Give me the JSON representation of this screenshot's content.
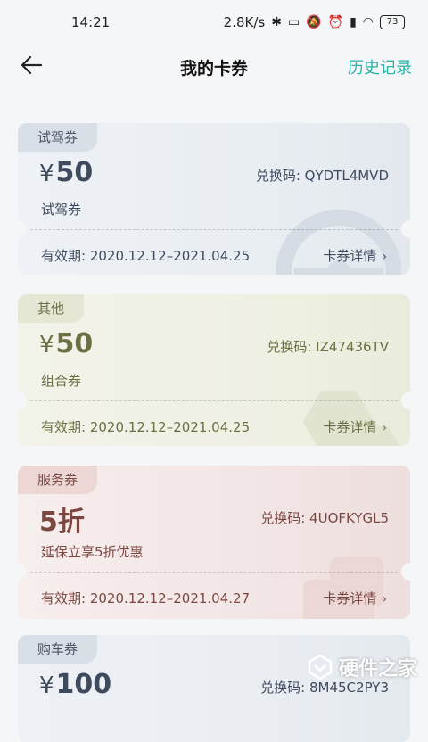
{
  "status_bar": {
    "time": "14:21",
    "speed": "2.8K/s",
    "battery": "73"
  },
  "header": {
    "title": "我的卡券",
    "history": "历史记录"
  },
  "coupons": [
    {
      "tag": "试驾券",
      "currency": "¥",
      "amount": "50",
      "name": "试驾券",
      "code_label": "兑换码:",
      "code": "QYDTL4MVD",
      "validity_label": "有效期:",
      "validity": "2020.12.12–2021.04.25",
      "detail": "卡券详情"
    },
    {
      "tag": "其他",
      "currency": "¥",
      "amount": "50",
      "name": "组合券",
      "code_label": "兑换码:",
      "code": "IZ47436TV",
      "validity_label": "有效期:",
      "validity": "2020.12.12–2021.04.25",
      "detail": "卡券详情"
    },
    {
      "tag": "服务券",
      "amount": "5折",
      "name": "延保立享5折优惠",
      "code_label": "兑换码:",
      "code": "4UOFKYGL5",
      "validity_label": "有效期:",
      "validity": "2020.12.12–2021.04.27",
      "detail": "卡券详情"
    },
    {
      "tag": "购车券",
      "currency": "¥",
      "amount": "100",
      "code_label": "兑换码:",
      "code": "8M45C2PY3"
    }
  ],
  "watermark": "硬件之家",
  "colors": {
    "accent": "#2bb3a8",
    "background": "#f5f6f7"
  }
}
